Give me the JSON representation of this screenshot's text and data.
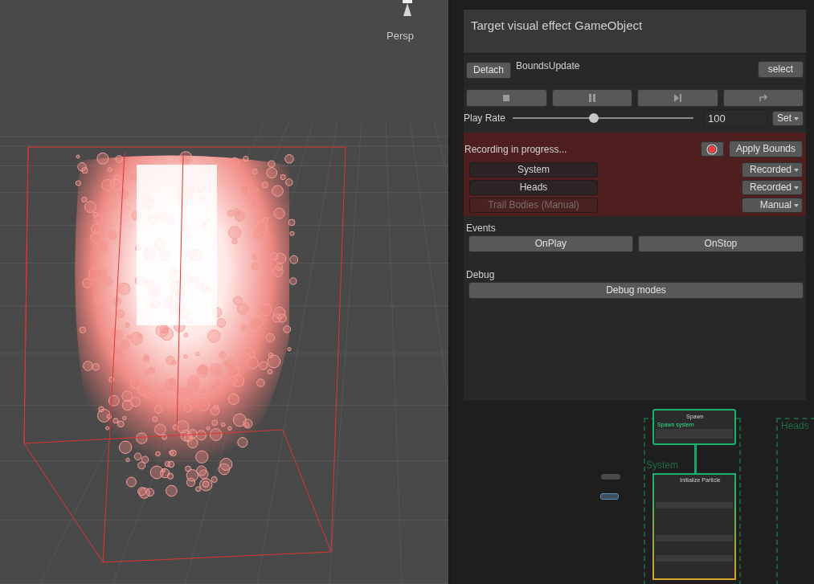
{
  "scene_view": {
    "camera_label": "Persp"
  },
  "inspector": {
    "title": "Target visual effect GameObject",
    "attach": {
      "detach": "Detach",
      "object": "BoundsUpdate",
      "select": "select"
    },
    "playback": {
      "play_rate_label": "Play Rate",
      "level": 0.45,
      "rate": "100",
      "set": "Set"
    },
    "recording": {
      "active": true,
      "status": "Recording in progress...",
      "apply": "Apply Bounds",
      "systems": [
        {
          "name": "System",
          "mode": "Recorded",
          "disabled": false
        },
        {
          "name": "Heads",
          "mode": "Recorded",
          "disabled": false
        },
        {
          "name": "Trail Bodies (Manual)",
          "mode": "Manual",
          "disabled": true
        }
      ]
    },
    "events": {
      "title": "Events",
      "buttons": [
        "OnPlay",
        "OnStop"
      ]
    },
    "debug": {
      "title": "Debug",
      "button": "Debug modes"
    }
  },
  "graph": {
    "spawn_node": {
      "title": "Spawn",
      "subtitle": "Spawn system"
    },
    "system_label": "System",
    "heads_label": "Heads",
    "init_node": {
      "title": "Initialize Particle"
    }
  }
}
